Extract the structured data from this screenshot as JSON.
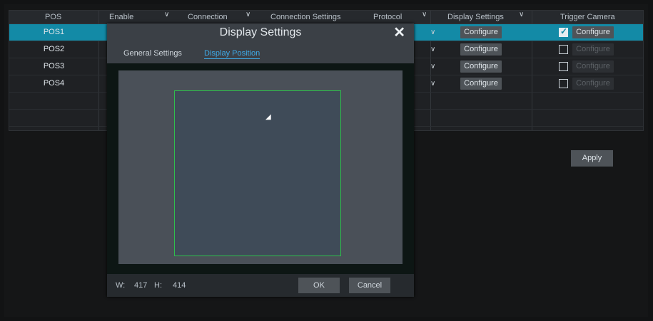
{
  "table": {
    "headers": {
      "pos": "POS",
      "enable": "Enable",
      "connection": "Connection",
      "connection_settings": "Connection Settings",
      "protocol": "Protocol",
      "display_settings": "Display Settings",
      "trigger_camera": "Trigger Camera"
    },
    "rows": [
      {
        "name": "POS1",
        "display_btn": "Configure",
        "trigger_checked": true,
        "trigger_btn": "Configure"
      },
      {
        "name": "POS2",
        "display_btn": "Configure",
        "trigger_checked": false,
        "trigger_btn": "Configure"
      },
      {
        "name": "POS3",
        "display_btn": "Configure",
        "trigger_checked": false,
        "trigger_btn": "Configure"
      },
      {
        "name": "POS4",
        "display_btn": "Configure",
        "trigger_checked": false,
        "trigger_btn": "Configure"
      }
    ]
  },
  "apply_label": "Apply",
  "dialog": {
    "title": "Display Settings",
    "close_icon": "close-icon",
    "tabs": {
      "general": "General Settings",
      "position": "Display Position"
    },
    "width_label": "W:",
    "width_value": "417",
    "height_label": "H:",
    "height_value": "414",
    "ok_label": "OK",
    "cancel_label": "Cancel"
  },
  "colors": {
    "selected_row": "#138aa6",
    "region_border": "#2fbf4c",
    "active_tab": "#3ea9e6"
  }
}
